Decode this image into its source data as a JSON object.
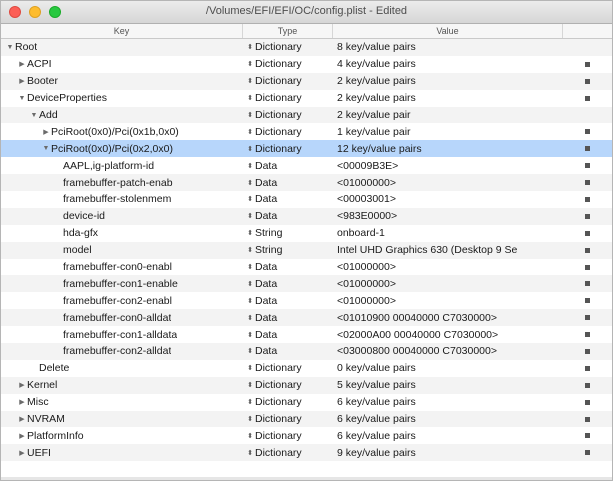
{
  "window": {
    "title": "/Volumes/EFI/EFI/OC/config.plist - Edited"
  },
  "columns": {
    "key": "Key",
    "type": "Type",
    "value": "Value"
  },
  "rows": [
    {
      "indent": 0,
      "disclosure": "open",
      "key": "Root",
      "type": "Dictionary",
      "value": "8 key/value pairs",
      "selected": false
    },
    {
      "indent": 1,
      "disclosure": "closed",
      "key": "ACPI",
      "type": "Dictionary",
      "value": "4 key/value pairs",
      "selected": false
    },
    {
      "indent": 1,
      "disclosure": "closed",
      "key": "Booter",
      "type": "Dictionary",
      "value": "2 key/value pairs",
      "selected": false
    },
    {
      "indent": 1,
      "disclosure": "open",
      "key": "DeviceProperties",
      "type": "Dictionary",
      "value": "2 key/value pairs",
      "selected": false
    },
    {
      "indent": 2,
      "disclosure": "open",
      "key": "Add",
      "type": "Dictionary",
      "value": "2 key/value pair",
      "selected": false
    },
    {
      "indent": 3,
      "disclosure": "closed",
      "key": "PciRoot(0x0)/Pci(0x1b,0x0)",
      "type": "Dictionary",
      "value": "1 key/value pair",
      "selected": false
    },
    {
      "indent": 3,
      "disclosure": "open",
      "key": "PciRoot(0x0)/Pci(0x2,0x0)",
      "type": "Dictionary",
      "value": "12 key/value pairs",
      "selected": true
    },
    {
      "indent": 4,
      "disclosure": "none",
      "key": "AAPL,ig-platform-id",
      "type": "Data",
      "value": "<00009B3E>",
      "selected": false
    },
    {
      "indent": 4,
      "disclosure": "none",
      "key": "framebuffer-patch-enab",
      "type": "Data",
      "value": "<01000000>",
      "selected": false
    },
    {
      "indent": 4,
      "disclosure": "none",
      "key": "framebuffer-stolenmem",
      "type": "Data",
      "value": "<00003001>",
      "selected": false
    },
    {
      "indent": 4,
      "disclosure": "none",
      "key": "device-id",
      "type": "Data",
      "value": "<983E0000>",
      "selected": false
    },
    {
      "indent": 4,
      "disclosure": "none",
      "key": "hda-gfx",
      "type": "String",
      "value": "onboard-1",
      "selected": false
    },
    {
      "indent": 4,
      "disclosure": "none",
      "key": "model",
      "type": "String",
      "value": "Intel UHD Graphics 630 (Desktop 9 Se",
      "selected": false
    },
    {
      "indent": 4,
      "disclosure": "none",
      "key": "framebuffer-con0-enabl",
      "type": "Data",
      "value": "<01000000>",
      "selected": false
    },
    {
      "indent": 4,
      "disclosure": "none",
      "key": "framebuffer-con1-enable",
      "type": "Data",
      "value": "<01000000>",
      "selected": false
    },
    {
      "indent": 4,
      "disclosure": "none",
      "key": "framebuffer-con2-enabl",
      "type": "Data",
      "value": "<01000000>",
      "selected": false
    },
    {
      "indent": 4,
      "disclosure": "none",
      "key": "framebuffer-con0-alldat",
      "type": "Data",
      "value": "<01010900 00040000 C7030000>",
      "selected": false
    },
    {
      "indent": 4,
      "disclosure": "none",
      "key": "framebuffer-con1-alldata",
      "type": "Data",
      "value": "<02000A00 00040000 C7030000>",
      "selected": false
    },
    {
      "indent": 4,
      "disclosure": "none",
      "key": "framebuffer-con2-alldat",
      "type": "Data",
      "value": "<03000800 00040000 C7030000>",
      "selected": false
    },
    {
      "indent": 2,
      "disclosure": "none",
      "key": "Delete",
      "type": "Dictionary",
      "value": "0 key/value pairs",
      "selected": false
    },
    {
      "indent": 1,
      "disclosure": "closed",
      "key": "Kernel",
      "type": "Dictionary",
      "value": "5 key/value pairs",
      "selected": false
    },
    {
      "indent": 1,
      "disclosure": "closed",
      "key": "Misc",
      "type": "Dictionary",
      "value": "6 key/value pairs",
      "selected": false
    },
    {
      "indent": 1,
      "disclosure": "closed",
      "key": "NVRAM",
      "type": "Dictionary",
      "value": "6 key/value pairs",
      "selected": false
    },
    {
      "indent": 1,
      "disclosure": "closed",
      "key": "PlatformInfo",
      "type": "Dictionary",
      "value": "6 key/value pairs",
      "selected": false
    },
    {
      "indent": 1,
      "disclosure": "closed",
      "key": "UEFI",
      "type": "Dictionary",
      "value": "9 key/value pairs",
      "selected": false
    }
  ],
  "icons": {
    "disclosure_open": "disclosure-open-icon",
    "disclosure_closed": "disclosure-closed-icon",
    "type_stepper": "type-stepper-icon",
    "row_action": "row-action-icon"
  },
  "colors": {
    "selection": "#b7d6fb",
    "close": "#fc5f57",
    "minimize": "#fdbc2e",
    "maximize": "#28c840"
  }
}
